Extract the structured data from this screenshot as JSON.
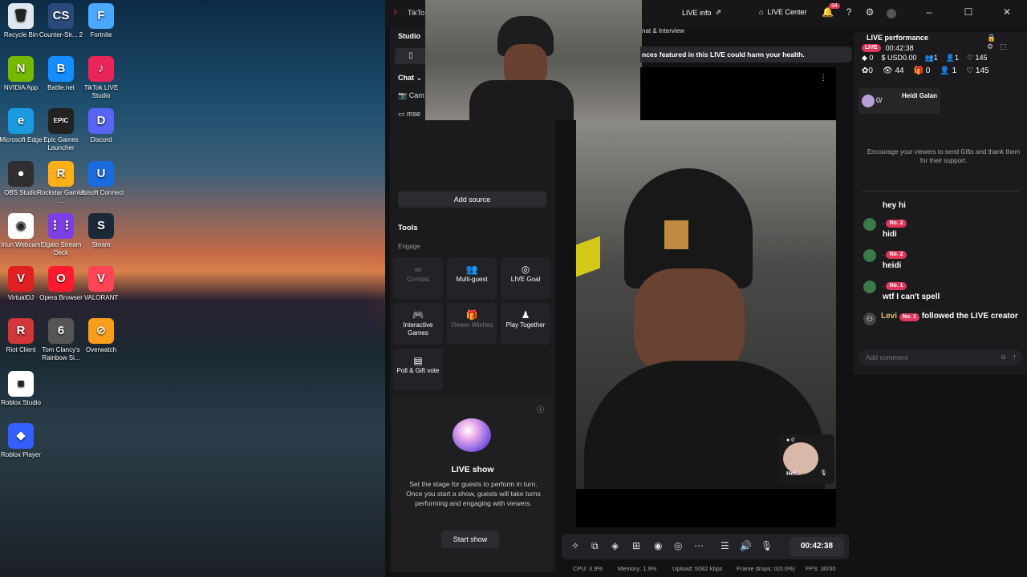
{
  "desktop_icons": [
    {
      "label": "Recycle Bin",
      "glyph": "🗑",
      "color": "#dfe8f0"
    },
    {
      "label": "Counter-Str... 2",
      "glyph": "CS",
      "color": "#2a4a7a"
    },
    {
      "label": "Fortnite",
      "glyph": "F",
      "color": "#4aa8ff"
    },
    {
      "label": "NVIDIA App",
      "glyph": "N",
      "color": "#76b900"
    },
    {
      "label": "Battle.net",
      "glyph": "B",
      "color": "#148eff"
    },
    {
      "label": "TikTok LIVE Studio",
      "glyph": "♪",
      "color": "#e8245a"
    },
    {
      "label": "Microsoft Edge",
      "glyph": "e",
      "color": "#1a9be0"
    },
    {
      "label": "Epic Games Launcher",
      "glyph": "EPIC",
      "color": "#222"
    },
    {
      "label": "Discord",
      "glyph": "D",
      "color": "#5865f2"
    },
    {
      "label": "OBS Studio",
      "glyph": "●",
      "color": "#302e31"
    },
    {
      "label": "Rockstar Games ...",
      "glyph": "R",
      "color": "#fcaf17"
    },
    {
      "label": "Ubisoft Connect",
      "glyph": "U",
      "color": "#1a6ae0"
    },
    {
      "label": "Iriun Webcam",
      "glyph": "◉",
      "color": "#fff"
    },
    {
      "label": "Elgato Stream Deck",
      "glyph": "⋮⋮",
      "color": "#7b3fe4"
    },
    {
      "label": "Steam",
      "glyph": "S",
      "color": "#1b2838"
    },
    {
      "label": "VirtualDJ",
      "glyph": "V",
      "color": "#e02020"
    },
    {
      "label": "Opera Browser",
      "glyph": "O",
      "color": "#ff1b2d"
    },
    {
      "label": "VALORANT",
      "glyph": "V",
      "color": "#fd4556"
    },
    {
      "label": "Riot Client",
      "glyph": "R",
      "color": "#d13639"
    },
    {
      "label": "Tom Clancy's Rainbow Si...",
      "glyph": "6",
      "color": "#555"
    },
    {
      "label": "Overwatch",
      "glyph": "⊘",
      "color": "#f99e1a"
    },
    {
      "label": "Roblox Studio",
      "glyph": "■",
      "color": "#fff"
    },
    {
      "label": "Roblox Player",
      "glyph": "◆",
      "color": "#335fff"
    }
  ],
  "studio": {
    "app_title": "TikTo",
    "live_info": "LIVE info",
    "live_center": "LIVE Center",
    "notif_count": "34",
    "left": {
      "header": "Studio",
      "chat_tab": "Chat",
      "source_1": "Cam",
      "source_2": "mse",
      "add_source": "Add source",
      "tools_title": "Tools",
      "engage_label": "Engage",
      "tools": [
        {
          "label": "Co-host",
          "icon": "∞",
          "enabled": false
        },
        {
          "label": "Multi-guest",
          "icon": "👥",
          "enabled": true
        },
        {
          "label": "LIVE Goal",
          "icon": "◎",
          "enabled": true
        },
        {
          "label": "Interactive Games",
          "icon": "🎮",
          "enabled": true
        },
        {
          "label": "Viewer Wishes",
          "icon": "🎁",
          "enabled": false
        },
        {
          "label": "Play Together",
          "icon": "♟",
          "enabled": true
        },
        {
          "label": "Poll & Gift vote",
          "icon": "▤",
          "enabled": true
        }
      ],
      "live_show_title": "LIVE show",
      "live_show_desc": "Set the stage for guests to perform in turn. Once you start a show, guests will take turns performing and engaging with viewers.",
      "start_show": "Start show"
    },
    "center": {
      "banner_left": "nat & Interview",
      "banner_warning": "nces featured in this LIVE could harm your health.",
      "guest_count": "0",
      "guest_name": "Hel..."
    },
    "right": {
      "title": "LIVE performance",
      "live_badge": "LIVE",
      "timer": "00:42:38",
      "stats_row1": {
        "coins": "0",
        "usd": "USD0.00",
        "a": "1",
        "b": "1",
        "likes": "145"
      },
      "stats_row2": {
        "c": "0",
        "viewers": "44",
        "gifts": "0",
        "d": "1",
        "likes": "145"
      },
      "top_guest_count": "0/",
      "top_guest_name": "Heidi Galan",
      "encourage": "Encourage your viewers to send Gifts and thank them for their support.",
      "messages": [
        {
          "name": "",
          "badge": "",
          "text": "hey hi"
        },
        {
          "name": ".",
          "badge": "No. 2",
          "text": "hidi"
        },
        {
          "name": ".",
          "badge": "No. 2",
          "text": "heidi"
        },
        {
          "name": ".",
          "badge": "No. 1",
          "text": "wtf I can't spell"
        }
      ],
      "follow_name": "Levi",
      "follow_badge": "No. 1",
      "follow_text": "followed the LIVE creator",
      "comment_placeholder": "Add comment"
    },
    "bottom": {
      "timer": "00:42:38",
      "cpu": "CPU:  3.9%",
      "memory": "Memory:  1.9%",
      "upload": "Upload:  5082 kbps",
      "frame_drops": "Frame drops:  0(0.0%)",
      "fps": "FPS:  30/30"
    }
  }
}
